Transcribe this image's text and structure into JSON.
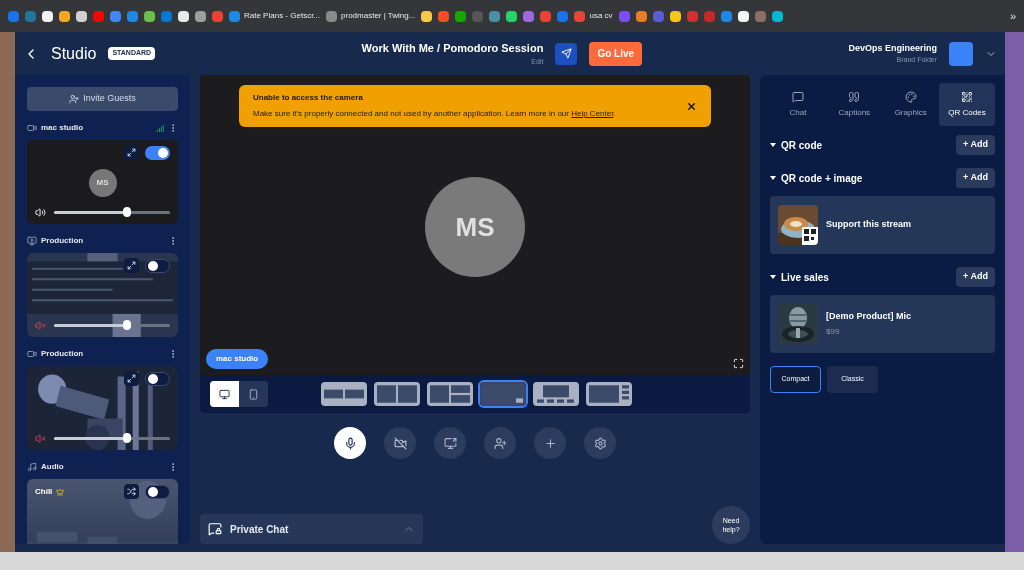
{
  "bookmarks": [
    {
      "color": "#1a73e8"
    },
    {
      "color": "#21759b"
    },
    {
      "color": "#f1f3f4"
    },
    {
      "color": "#f5a623"
    },
    {
      "color": "#d0d0d0"
    },
    {
      "color": "#ff0000"
    },
    {
      "color": "#4285f4"
    },
    {
      "color": "#1e88e5"
    },
    {
      "color": "#6abf4b"
    },
    {
      "color": "#0078d4"
    },
    {
      "color": "#e8e8e8"
    },
    {
      "color": "#9e9e9e"
    },
    {
      "color": "#ea4335"
    },
    {
      "label": "Rate Plans - Getscr...",
      "color": "#1e88e5"
    },
    {
      "label": "prodmaster | Twing...",
      "color": "#8a8a8a"
    },
    {
      "color": "#f7c948"
    },
    {
      "color": "#f25022"
    },
    {
      "color": "#14a800"
    },
    {
      "color": "#555555"
    },
    {
      "color": "#4a90a4"
    },
    {
      "color": "#25d366"
    },
    {
      "color": "#9c6ade"
    },
    {
      "color": "#ea4335"
    },
    {
      "color": "#1a73e8"
    },
    {
      "label": "usa cv",
      "color": "#ea4335"
    },
    {
      "color": "#7c4dff"
    },
    {
      "color": "#e67e22"
    },
    {
      "color": "#5b5bd6"
    },
    {
      "color": "#f5c518"
    },
    {
      "color": "#d32f2f"
    },
    {
      "color": "#c62828"
    },
    {
      "color": "#1e88e5"
    },
    {
      "color": "#f5f5f5"
    },
    {
      "color": "#8d6e63"
    },
    {
      "color": "#00b8d4"
    }
  ],
  "bookmarks_more": "»",
  "header": {
    "title": "Studio",
    "plan": "STANDARD",
    "session_title": "Work With Me / Pomodoro Session",
    "edit": "Edit",
    "go_live": "Go Live",
    "brand": "DevOps Engineering",
    "brand_sub": "Brand Folder"
  },
  "invite": "Invite Guests",
  "sources": [
    {
      "kind": "camera",
      "title": "mac studio",
      "initials": "MS",
      "on": true,
      "muted": false,
      "level": 0.63
    },
    {
      "kind": "screen",
      "title": "Production",
      "on": false,
      "muted": true,
      "level": 0.63
    },
    {
      "kind": "video",
      "title": "Production",
      "on": false,
      "muted": true,
      "level": 0.63
    },
    {
      "kind": "audio",
      "title": "Audio",
      "track": "Chill",
      "on": false
    }
  ],
  "alert": {
    "title": "Unable to access the camera",
    "message": "Make sure it's properly connected and not used by another application. Learn more in our ",
    "link": "Help Center",
    "after": "."
  },
  "stage": {
    "initials": "MS",
    "name_tag": "mac studio"
  },
  "view_modes": [
    {
      "kind": "desktop",
      "selected": true
    },
    {
      "kind": "mobile",
      "selected": false
    }
  ],
  "layouts": [
    {
      "kind": "split-banner",
      "selected": false
    },
    {
      "kind": "two-up",
      "selected": false
    },
    {
      "kind": "one-two",
      "selected": false
    },
    {
      "kind": "pip",
      "selected": true
    },
    {
      "kind": "bottom-strip",
      "selected": false
    },
    {
      "kind": "side-strip",
      "selected": false
    }
  ],
  "controls": [
    {
      "kind": "mic",
      "selected": true
    },
    {
      "kind": "camera-off",
      "selected": false
    },
    {
      "kind": "share",
      "selected": false
    },
    {
      "kind": "add-guest",
      "selected": false
    },
    {
      "kind": "add",
      "selected": false
    },
    {
      "kind": "settings",
      "selected": false
    }
  ],
  "private_chat": "Private Chat",
  "need_help": "Need help?",
  "tabs": [
    {
      "kind": "chat",
      "label": "Chat",
      "selected": false
    },
    {
      "kind": "captions",
      "label": "Captions",
      "selected": false
    },
    {
      "kind": "graphics",
      "label": "Graphics",
      "selected": false
    },
    {
      "kind": "qr",
      "label": "QR Codes",
      "selected": true
    }
  ],
  "sections": [
    {
      "title": "QR code",
      "expanded": true,
      "add": "+ Add"
    },
    {
      "title": "QR code + image",
      "expanded": true,
      "add": "+ Add",
      "items": [
        {
          "kind": "qr-image",
          "title": "Support this stream"
        }
      ]
    },
    {
      "title": "Live sales",
      "expanded": true,
      "add": "+ Add",
      "items": [
        {
          "kind": "product",
          "title": "[Demo Product] Mic",
          "price": "$99"
        }
      ]
    }
  ],
  "styles": [
    {
      "label": "Compact",
      "selected": true
    },
    {
      "label": "Classic",
      "selected": false
    }
  ]
}
